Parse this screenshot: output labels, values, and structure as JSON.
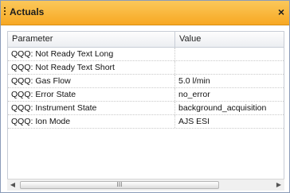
{
  "panel": {
    "title": "Actuals",
    "close_glyph": "×"
  },
  "table": {
    "columns": [
      "Parameter",
      "Value"
    ],
    "rows": [
      {
        "parameter": "QQQ:  Not Ready Text Long",
        "value": ""
      },
      {
        "parameter": "QQQ:  Not Ready Text Short",
        "value": ""
      },
      {
        "parameter": "QQQ:  Gas Flow",
        "value": "5.0 l/min"
      },
      {
        "parameter": "QQQ:  Error State",
        "value": "no_error"
      },
      {
        "parameter": "QQQ:  Instrument State",
        "value": "background_acquisition"
      },
      {
        "parameter": "QQQ:  Ion Mode",
        "value": "AJS ESI"
      }
    ]
  },
  "scrollbar": {
    "left_glyph": "◀",
    "right_glyph": "▶",
    "thumb_glyph": "III"
  },
  "colors": {
    "titlebar_top": "#fbc85a",
    "titlebar_bottom": "#f7a823",
    "accent_bar": "#7f9ccc"
  }
}
